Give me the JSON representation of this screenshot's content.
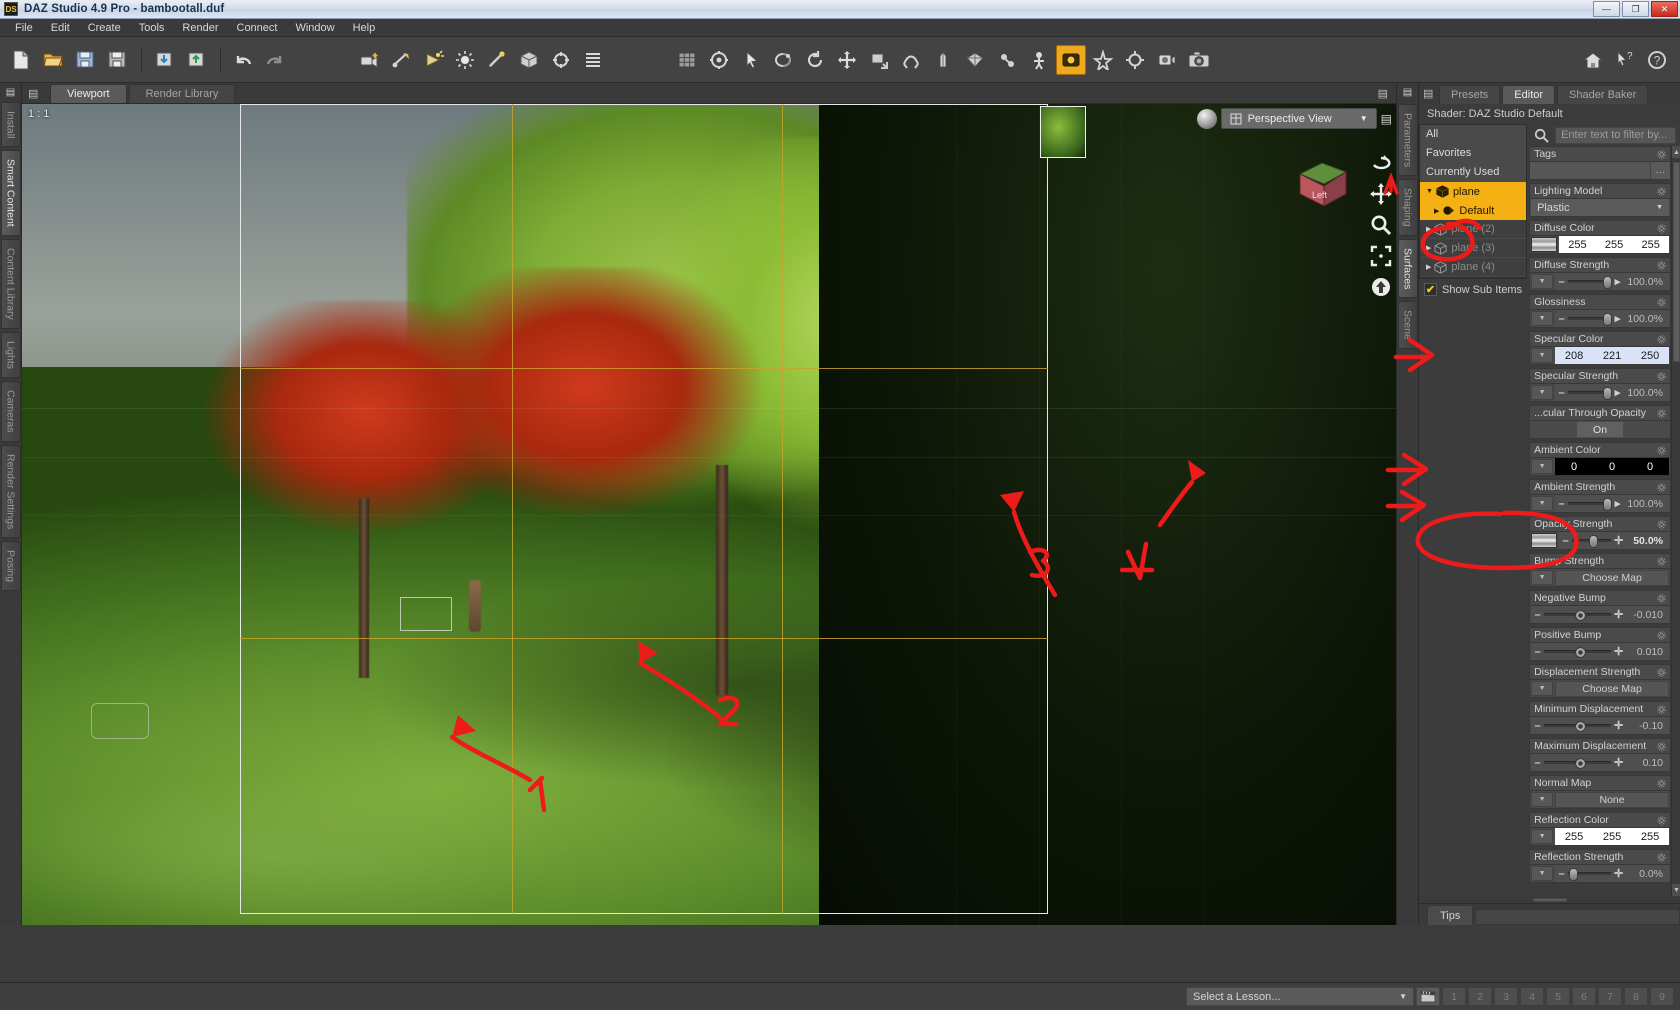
{
  "titlebar": {
    "app_icon": "ds-logo-icon",
    "title": "DAZ Studio 4.9 Pro - bambootall.duf",
    "minimize": "—",
    "maximize": "❐",
    "close": "✕"
  },
  "menubar": {
    "items": [
      "File",
      "Edit",
      "Create",
      "Tools",
      "Render",
      "Connect",
      "Window",
      "Help"
    ]
  },
  "toolbar": {
    "groups": [
      [
        "new-document-icon",
        "open-file-icon",
        "save-as-icon",
        "save-icon"
      ],
      [
        "import-icon",
        "export-icon"
      ],
      [
        "undo-icon",
        "redo-icon"
      ],
      [
        "add-camera-icon",
        "add-distant-light-icon",
        "add-spot-light-icon",
        "add-point-light-icon",
        "add-linear-light-icon",
        "add-primitive-icon",
        "add-null-icon",
        "list-icon"
      ],
      [
        "grid-snap-icon",
        "node-select-icon",
        "pointer-tool-icon",
        "rotate-view-icon",
        "orbit-icon",
        "translate-tool-icon",
        "pan-view-icon",
        "surface-select-icon",
        "mesh-grabber-icon",
        "geometry-editor-icon",
        "joint-editor-icon",
        "puppeteer-icon",
        "active-pose-icon",
        "power-pose-icon",
        "spot-render-icon",
        "render-settings-icon",
        "render-icon"
      ],
      [
        "home-icon",
        "help-cursor-icon",
        "about-icon"
      ]
    ],
    "active_tool": "active-pose-icon"
  },
  "left_tabs": {
    "items": [
      "Install",
      "Smart Content",
      "Content Library",
      "Lights",
      "Cameras",
      "Render Settings",
      "Posing"
    ],
    "selected": "Smart Content"
  },
  "viewport": {
    "tabs": [
      {
        "label": "Viewport",
        "selected": true
      },
      {
        "label": "Render Library",
        "selected": false
      }
    ],
    "aspect_ratio_label": "1 : 1",
    "camera_dropdown": "Perspective View",
    "view_cube_face": "Left",
    "side_icons": [
      "orbit-camera-icon",
      "pan-camera-icon",
      "zoom-camera-icon",
      "frame-selection-icon",
      "reset-camera-icon"
    ]
  },
  "right_tabs": {
    "items": [
      "Parameters",
      "Shaping",
      "Surfaces",
      "Scene"
    ],
    "selected": "Surfaces"
  },
  "surfaces_panel": {
    "top_tabs": [
      {
        "label": "Presets",
        "selected": false
      },
      {
        "label": "Editor",
        "selected": true
      },
      {
        "label": "Shader Baker",
        "selected": false
      }
    ],
    "shader_line": "Shader: DAZ Studio Default",
    "tree": [
      {
        "label": "All",
        "type": "group",
        "selected": false,
        "dim": false
      },
      {
        "label": "Favorites",
        "type": "group",
        "selected": false,
        "dim": false
      },
      {
        "label": "Currently Used",
        "type": "group",
        "selected": false,
        "dim": false
      },
      {
        "label": "plane",
        "type": "node",
        "selected": true,
        "dim": false,
        "expanded": true
      },
      {
        "label": "Default",
        "type": "surface",
        "selected": true,
        "dim": false,
        "indent": true
      },
      {
        "label": "plane (2)",
        "type": "node",
        "selected": false,
        "dim": true
      },
      {
        "label": "plane (3)",
        "type": "node",
        "selected": false,
        "dim": true
      },
      {
        "label": "plane (4)",
        "type": "node",
        "selected": false,
        "dim": true
      }
    ],
    "show_sub_items_label": "Show Sub Items",
    "show_sub_items_checked": true,
    "search_placeholder": "Enter text to filter by...",
    "properties": [
      {
        "name": "Tags",
        "kind": "tagsfield",
        "value": ""
      },
      {
        "name": "Lighting Model",
        "kind": "dropdown",
        "value": "Plastic"
      },
      {
        "name": "Diffuse Color",
        "kind": "color",
        "value": [
          "255",
          "255",
          "255"
        ],
        "field": "white",
        "map": true
      },
      {
        "name": "Diffuse Strength",
        "kind": "slider",
        "value": "100.0%",
        "pos": 82
      },
      {
        "name": "Glossiness",
        "kind": "slider",
        "value": "100.0%",
        "pos": 82
      },
      {
        "name": "Specular Color",
        "kind": "color",
        "value": [
          "208",
          "221",
          "250"
        ],
        "field": "blue",
        "map": false
      },
      {
        "name": "Specular Strength",
        "kind": "slider",
        "value": "100.0%",
        "pos": 82
      },
      {
        "name": "...cular Through Opacity",
        "kind": "onoff",
        "value": "On"
      },
      {
        "name": "Ambient Color",
        "kind": "color",
        "value": [
          "0",
          "0",
          "0"
        ],
        "field": "black",
        "map": false
      },
      {
        "name": "Ambient Strength",
        "kind": "slider",
        "value": "100.0%",
        "pos": 82
      },
      {
        "name": "Opacity Strength",
        "kind": "slider-map",
        "value": "50.0%",
        "pos": 44
      },
      {
        "name": "Bump Strength",
        "kind": "mapbutton",
        "value": "Choose Map"
      },
      {
        "name": "Negative Bump",
        "kind": "slider-centered",
        "value": "-0.010",
        "pos": 46
      },
      {
        "name": "Positive Bump",
        "kind": "slider-centered",
        "value": "0.010",
        "pos": 46
      },
      {
        "name": "Displacement Strength",
        "kind": "mapbutton",
        "value": "Choose Map"
      },
      {
        "name": "Minimum Displacement",
        "kind": "slider-centered",
        "value": "-0.10",
        "pos": 46
      },
      {
        "name": "Maximum Displacement",
        "kind": "slider-centered",
        "value": "0.10",
        "pos": 46
      },
      {
        "name": "Normal Map",
        "kind": "mapbutton",
        "value": "None"
      },
      {
        "name": "Reflection Color",
        "kind": "color",
        "value": [
          "255",
          "255",
          "255"
        ],
        "field": "white",
        "map": false
      },
      {
        "name": "Reflection Strength",
        "kind": "slider",
        "value": "0.0%",
        "pos": 4
      }
    ]
  },
  "tips_bar": {
    "tab_label": "Tips"
  },
  "bottom_bar": {
    "lesson_select": "Select a Lesson...",
    "clapper_icon": "film-clapper-icon",
    "numbers": [
      "1",
      "2",
      "3",
      "4",
      "5",
      "6",
      "7",
      "8",
      "9"
    ]
  },
  "annotations": {
    "color": "#ee1b1b",
    "marks": [
      {
        "id": "viewport-arrow-1",
        "label": "1",
        "target": "ground-left-foreground"
      },
      {
        "id": "viewport-arrow-2",
        "label": "2",
        "target": "ground-center-foreground"
      },
      {
        "id": "viewport-arrow-3",
        "label": "3",
        "target": "ground-right-mid"
      },
      {
        "id": "viewport-arrow-4",
        "label": "4",
        "target": "ground-right-far"
      },
      {
        "id": "tree-arrow-1",
        "label": "1",
        "target": "plane-surface-node"
      },
      {
        "id": "circle-diffuse-color",
        "label": "",
        "target": "Diffuse Color"
      },
      {
        "id": "arrow-specular-color",
        "label": "",
        "target": "Specular Color"
      },
      {
        "id": "arrow-ambient-color",
        "label": "",
        "target": "Ambient Color"
      },
      {
        "id": "arrow-ambient-strength",
        "label": "",
        "target": "Ambient Strength"
      },
      {
        "id": "circle-opacity-strength",
        "label": "",
        "target": "Opacity Strength"
      }
    ]
  }
}
